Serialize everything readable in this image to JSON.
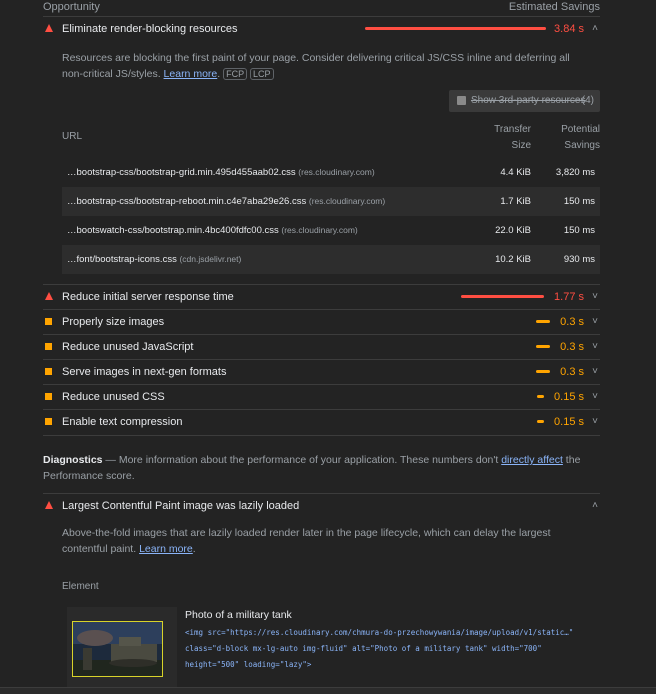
{
  "header": {
    "opportunity": "Opportunity",
    "estimated_savings": "Estimated Savings"
  },
  "expanded_audit": {
    "title": "Eliminate render-blocking resources",
    "savings": "3.84 s",
    "savings_fraction": 1.0,
    "description": "Resources are blocking the first paint of your page. Consider delivering critical JS/CSS inline and deferring all non-critical JS/styles.",
    "learn_more": "Learn more",
    "chips": [
      "FCP",
      "LCP"
    ],
    "third_party_label": "Show 3rd-party resources",
    "third_party_count": "(4)",
    "table": {
      "col_url": "URL",
      "col_transfer_1": "Transfer",
      "col_transfer_2": "Size",
      "col_potential_1": "Potential",
      "col_potential_2": "Savings",
      "rows": [
        {
          "url": "…bootstrap-css/bootstrap-grid.min.495d455aab02.css",
          "host": "(res.cloudinary.com)",
          "size": "4.4 KiB",
          "savings": "3,820 ms"
        },
        {
          "url": "…bootstrap-css/bootstrap-reboot.min.c4e7aba29e26.css",
          "host": "(res.cloudinary.com)",
          "size": "1.7 KiB",
          "savings": "150 ms"
        },
        {
          "url": "…bootswatch-css/bootstrap.min.4bc400fdfc00.css",
          "host": "(res.cloudinary.com)",
          "size": "22.0 KiB",
          "savings": "150 ms"
        },
        {
          "url": "…font/bootstrap-icons.css",
          "host": "(cdn.jsdelivr.net)",
          "size": "10.2 KiB",
          "savings": "930 ms"
        }
      ]
    }
  },
  "audits": [
    {
      "title": "Reduce initial server response time",
      "savings": "1.77 s",
      "severity": "fail",
      "savings_fraction": 0.46
    },
    {
      "title": "Properly size images",
      "savings": "0.3 s",
      "severity": "average",
      "savings_fraction": 0.08
    },
    {
      "title": "Reduce unused JavaScript",
      "savings": "0.3 s",
      "severity": "average",
      "savings_fraction": 0.08
    },
    {
      "title": "Serve images in next-gen formats",
      "savings": "0.3 s",
      "severity": "average",
      "savings_fraction": 0.08
    },
    {
      "title": "Reduce unused CSS",
      "savings": "0.15 s",
      "severity": "average",
      "savings_fraction": 0.04
    },
    {
      "title": "Enable text compression",
      "savings": "0.15 s",
      "severity": "average",
      "savings_fraction": 0.04
    }
  ],
  "diagnostics": {
    "heading": "Diagnostics",
    "text_before": " — More information about the performance of your application. These numbers don't ",
    "link": "directly affect",
    "text_after": " the Performance score."
  },
  "lcp_audit": {
    "title": "Largest Contentful Paint image was lazily loaded",
    "description": "Above-the-fold images that are lazily loaded render later in the page lifecycle, which can delay the largest contentful paint.",
    "learn_more": "Learn more",
    "element_label": "Element",
    "snippet_title": "Photo of a military tank",
    "code_line1": "<img src=\"https://res.cloudinary.com/chmura-do-przechowywania/image/upload/v1/static…\"",
    "code_line2": "class=\"d-block mx-lg-auto img-fluid\" alt=\"Photo of a military tank\" width=\"700\"",
    "code_line3": "height=\"500\" loading=\"lazy\">"
  },
  "colors": {
    "fail": "#ff4e42",
    "average": "#ffa400",
    "link": "#8ab4f8"
  }
}
